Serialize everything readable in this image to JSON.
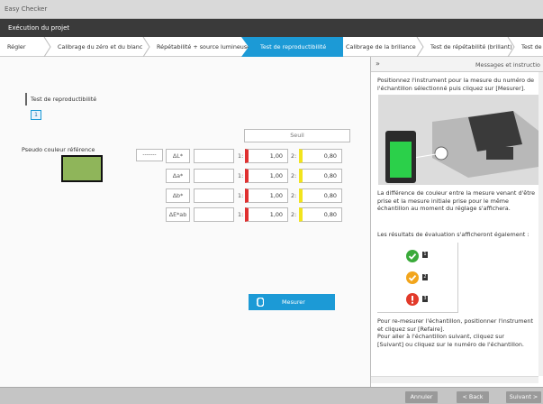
{
  "window": {
    "title": "Easy Checker"
  },
  "header": {
    "title": "Exécution du projet"
  },
  "breadcrumb": [
    {
      "label": "Régler"
    },
    {
      "label": "Calibrage du zéro et du blanc"
    },
    {
      "label": "Répétabilité + source lumineuse"
    },
    {
      "label": "Test de reproductibilité",
      "active": true
    },
    {
      "label": "Calibrage de la brillance"
    },
    {
      "label": "Test de répétabilité (brillant)"
    },
    {
      "label": "Test de r"
    }
  ],
  "test": {
    "title": "Test de reproductibilité",
    "sample_number": "1"
  },
  "reference": {
    "label": "Pseudo couleur référence",
    "swatch_color": "#8fb55a",
    "dash_button": "-------"
  },
  "threshold": {
    "header": "Seuil"
  },
  "rows": [
    {
      "delta": "ΔL*",
      "idx1": "1:",
      "v1": "1,00",
      "idx2": "2:",
      "v2": "0,80"
    },
    {
      "delta": "Δa*",
      "idx1": "1:",
      "v1": "1,00",
      "idx2": "2:",
      "v2": "0,80"
    },
    {
      "delta": "Δb*",
      "idx1": "1:",
      "v1": "1,00",
      "idx2": "2:",
      "v2": "0,80"
    },
    {
      "delta": "ΔE*ab",
      "idx1": "1:",
      "v1": "1,00",
      "idx2": "2:",
      "v2": "0,80"
    }
  ],
  "measure_button": {
    "label": "Mesurer"
  },
  "panel": {
    "toggle": "»",
    "title": "Messages et instructio",
    "text1": [
      "Positionnez l'instrument pour la mesure du numéro de",
      "l'échantillon sélectionné puis cliquez sur [Mesurer]."
    ],
    "text2": [
      "La différence de couleur entre la mesure venant d'être",
      "prise et la mesure initiale prise pour le même",
      "échantillon au moment du réglage s'affichera."
    ],
    "text3": "Les résultats de évaluation s'afficheront également :",
    "results": [
      {
        "num": "1",
        "color": "#3aaa3a"
      },
      {
        "num": "2",
        "color": "#f2a51c"
      },
      {
        "num": "3",
        "color": "#e23a2a"
      }
    ],
    "text4": [
      "Pour re-mesurer l'échantillon, positionner l'instrument",
      "et cliquez sur [Refaire].",
      "Pour aller à l'échantillon suivant, cliquez sur",
      "[Suivant] ou cliquez sur le numéro de l'échantillon."
    ]
  },
  "footer": {
    "cancel": "Annuler",
    "back": "< Back",
    "next": "Suivant >"
  }
}
